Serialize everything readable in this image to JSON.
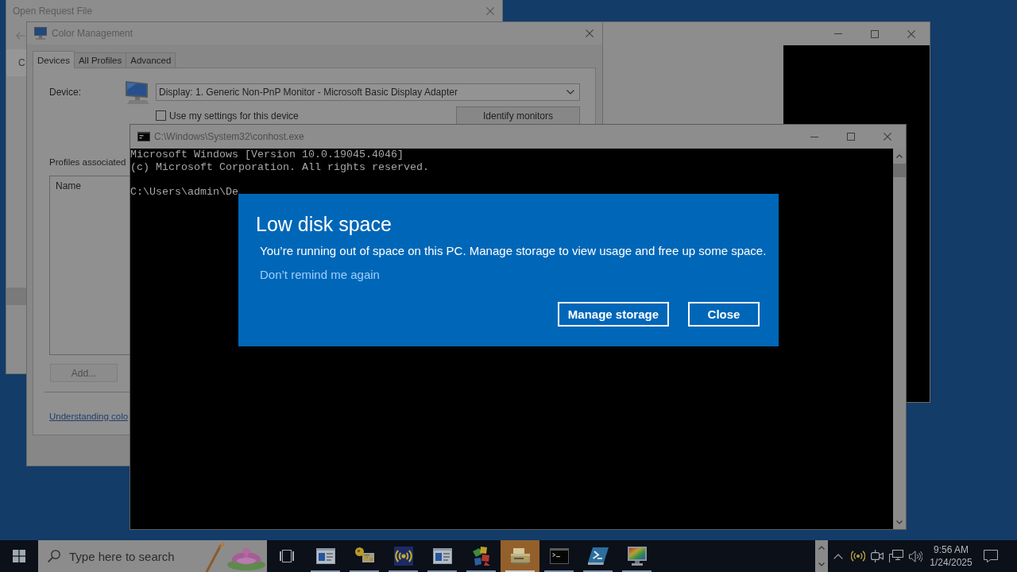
{
  "open_request_file": {
    "title": "Open Request File",
    "column_header": "C"
  },
  "color_management": {
    "title": "Color Management",
    "tabs": [
      {
        "label": "Devices",
        "selected": true
      },
      {
        "label": "All Profiles",
        "selected": false
      },
      {
        "label": "Advanced",
        "selected": false
      }
    ],
    "device_label": "Device:",
    "device": "Display: 1. Generic Non-PnP Monitor - Microsoft Basic Display Adapter",
    "use_my_settings": {
      "label": "Use my settings for this device",
      "checked": false
    },
    "identify_button": "Identify monitors",
    "profiles_label": "Profiles associated",
    "profiles_list": {
      "columns": [
        "Name"
      ]
    },
    "add_button": {
      "label": "Add...",
      "disabled": true
    },
    "help_link": "Understanding colo"
  },
  "console": {
    "title": "C:\\Windows\\System32\\conhost.exe",
    "output": [
      "Microsoft Windows [Version 10.0.19045.4046]",
      "(c) Microsoft Corporation. All rights reserved."
    ],
    "prompt": "C:\\Users\\admin\\De"
  },
  "dialog": {
    "title": "Low disk space",
    "message": "You’re running out of space on this PC. Manage storage to view usage and free up some space.",
    "link": "Don’t remind me again",
    "buttons": [
      "Manage storage",
      "Close"
    ]
  },
  "taskbar": {
    "search": {
      "placeholder": "Type here to search"
    },
    "apps": [
      {
        "selected": false
      },
      {
        "selected": false
      },
      {
        "selected": false
      },
      {
        "selected": false
      },
      {
        "selected": false
      },
      {
        "selected": true
      },
      {
        "selected": false
      },
      {
        "selected": false
      },
      {
        "selected": false
      }
    ],
    "clock": {
      "time": "9:56 AM",
      "date": "1/24/2025"
    }
  }
}
